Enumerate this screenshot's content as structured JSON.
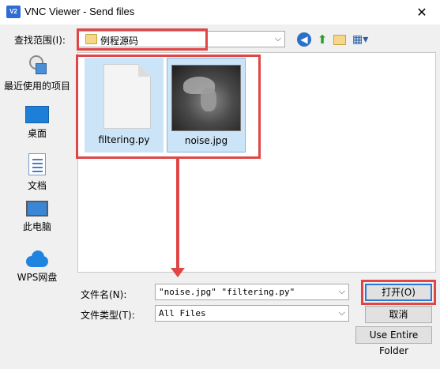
{
  "window": {
    "app_icon": "V2",
    "title": "VNC Viewer - Send files",
    "close_glyph": "✕"
  },
  "lookin": {
    "label": "查找范围(I):",
    "folder": "例程源码"
  },
  "places": [
    {
      "label": "最近使用的项目",
      "icon": "recent-icon"
    },
    {
      "label": "桌面",
      "icon": "desktop-icon"
    },
    {
      "label": "文档",
      "icon": "documents-icon"
    },
    {
      "label": "此电脑",
      "icon": "computer-icon"
    },
    {
      "label": "WPS网盘",
      "icon": "cloud-icon"
    }
  ],
  "files": [
    {
      "name": "filtering.py",
      "icon": "blank-file-icon"
    },
    {
      "name": "noise.jpg",
      "icon": "image-thumbnail-icon"
    }
  ],
  "filename": {
    "label": "文件名(N):",
    "value": "\"noise.jpg\" \"filtering.py\""
  },
  "filetype": {
    "label": "文件类型(T):",
    "value": "All Files"
  },
  "buttons": {
    "open": "打开(O)",
    "cancel": "取消",
    "use_entire_folder": "Use Entire Folder"
  },
  "colors": {
    "highlight": "#e04646",
    "selection": "#cce4f7",
    "accent": "#2a78d8"
  }
}
